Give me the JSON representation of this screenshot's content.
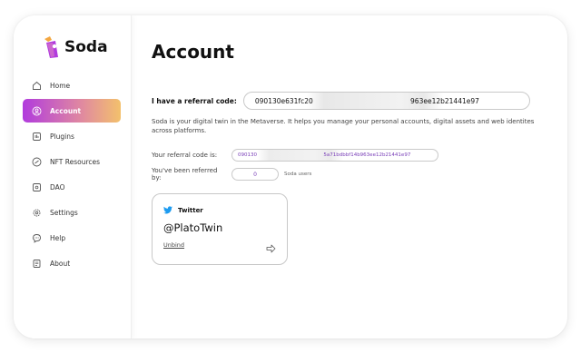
{
  "app": {
    "name": "Soda"
  },
  "sidebar": {
    "items": [
      {
        "label": "Home",
        "icon": "home-icon",
        "active": false
      },
      {
        "label": "Account",
        "icon": "user-icon",
        "active": true
      },
      {
        "label": "Plugins",
        "icon": "plugins-icon",
        "active": false
      },
      {
        "label": "NFT Resources",
        "icon": "nft-icon",
        "active": false
      },
      {
        "label": "DAO",
        "icon": "dao-icon",
        "active": false
      },
      {
        "label": "Settings",
        "icon": "gear-icon",
        "active": false
      },
      {
        "label": "Help",
        "icon": "help-icon",
        "active": false
      },
      {
        "label": "About",
        "icon": "about-icon",
        "active": false
      }
    ]
  },
  "main": {
    "title": "Account",
    "referral_input": {
      "label": "I have a referral code:",
      "value": "090130e631fc20                                             963ee12b21441e97"
    },
    "description": "Soda is your digital twin in the Metaverse. It helps you manage your personal accounts, digital assets and web identites across platforms.",
    "your_code": {
      "label": "Your referral code is:",
      "value": "090130                                          5a71bdbbf14b963ee12b21441e97"
    },
    "referred_by": {
      "label": "You've been referred by:",
      "count": "0",
      "unit": "Soda users"
    },
    "twitter_card": {
      "platform": "Twitter",
      "handle": "@PlatoTwin",
      "unbind_label": "Unbind"
    }
  },
  "colors": {
    "accent_gradient_start": "#b13bdd",
    "accent_gradient_end": "#f3c16c",
    "twitter_blue": "#1d9bf0",
    "code_purple": "#7a3fb8"
  }
}
